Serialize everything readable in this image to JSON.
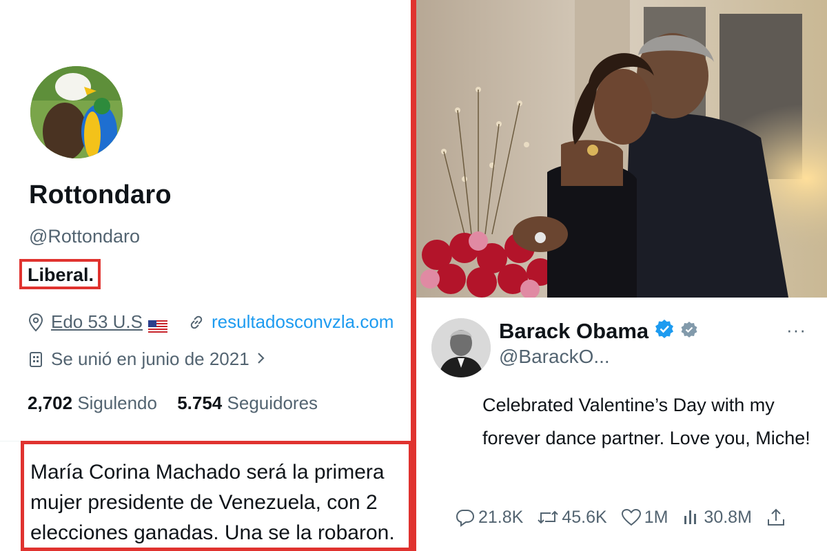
{
  "profile": {
    "name": "Rottondaro",
    "handle": "@Rottondaro",
    "bio": "Liberal.",
    "location": "Edo 53 U.S",
    "website": "resultadosconvzla.com",
    "joined": "Se unió en junio de 2021",
    "following_count": "2,702",
    "following_label": "Sigulendo",
    "followers_count": "5.754",
    "followers_label": "Seguidores",
    "tweet_name": "María Corina Machado",
    "tweet_rest": " será la primera mujer presidente de Venezuela, con 2 elecciones ganadas. Una se la robaron."
  },
  "obama_post": {
    "name": "Barack Obama",
    "handle": "@BarackO...",
    "more": "···",
    "text": "Celebrated Valentine’s Day with my forever dance partner. Love you, Miche!",
    "replies": "21.8K",
    "reposts": "45.6K",
    "likes": "1M",
    "views": "30.8M"
  },
  "colors": {
    "highlight": "#e0332f",
    "link": "#1d9bf0",
    "verified": "#1d9bf0",
    "text_secondary": "#536471"
  },
  "icons": [
    "location-icon",
    "link-icon",
    "calendar-icon",
    "chevron-right-icon",
    "verified-badge-icon",
    "affiliate-badge-icon",
    "more-icon",
    "reply-icon",
    "repost-icon",
    "like-icon",
    "views-icon",
    "share-icon"
  ]
}
